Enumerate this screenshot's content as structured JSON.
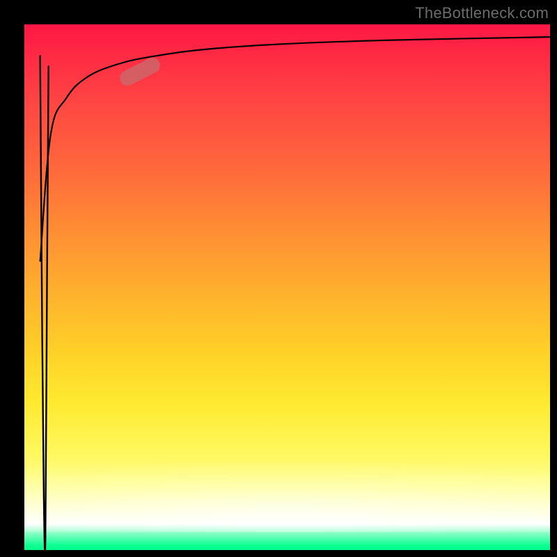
{
  "watermark": "TheBottleneck.com",
  "colors": {
    "bg": "#000000",
    "watermark": "#6b6b6b",
    "curve": "#000000",
    "marker": "rgba(197,110,110,0.75)",
    "gradient_top": "#ff1744",
    "gradient_bottom": "#00ff88"
  },
  "chart_data": {
    "type": "line",
    "title": "",
    "xlabel": "",
    "ylabel": "",
    "xlim": [
      0,
      100
    ],
    "ylim": [
      0,
      100
    ],
    "grid": false,
    "legend": false,
    "background": "vertical-gradient red→orange→yellow→white→green",
    "curves": [
      {
        "name": "spike",
        "description": "narrow near-vertical spike near x≈3 dropping from y≈94 to y≈2 and back up",
        "x": [
          3.0,
          3.4,
          3.7,
          4.0,
          4.3,
          4.6
        ],
        "y": [
          94,
          40,
          10,
          2,
          50,
          92
        ]
      },
      {
        "name": "log-top",
        "description": "steep rise from left edge asymptotically approaching the top",
        "x": [
          3,
          5,
          8,
          12,
          18,
          25,
          35,
          50,
          70,
          100
        ],
        "y": [
          55,
          79,
          86,
          90,
          92.5,
          94,
          95.3,
          96.3,
          97,
          97.6
        ]
      }
    ],
    "marker": {
      "description": "rounded pink pill on the upper-left bend of the log-top curve",
      "center_x": 22,
      "center_y": 91,
      "angle_deg": -27
    }
  }
}
